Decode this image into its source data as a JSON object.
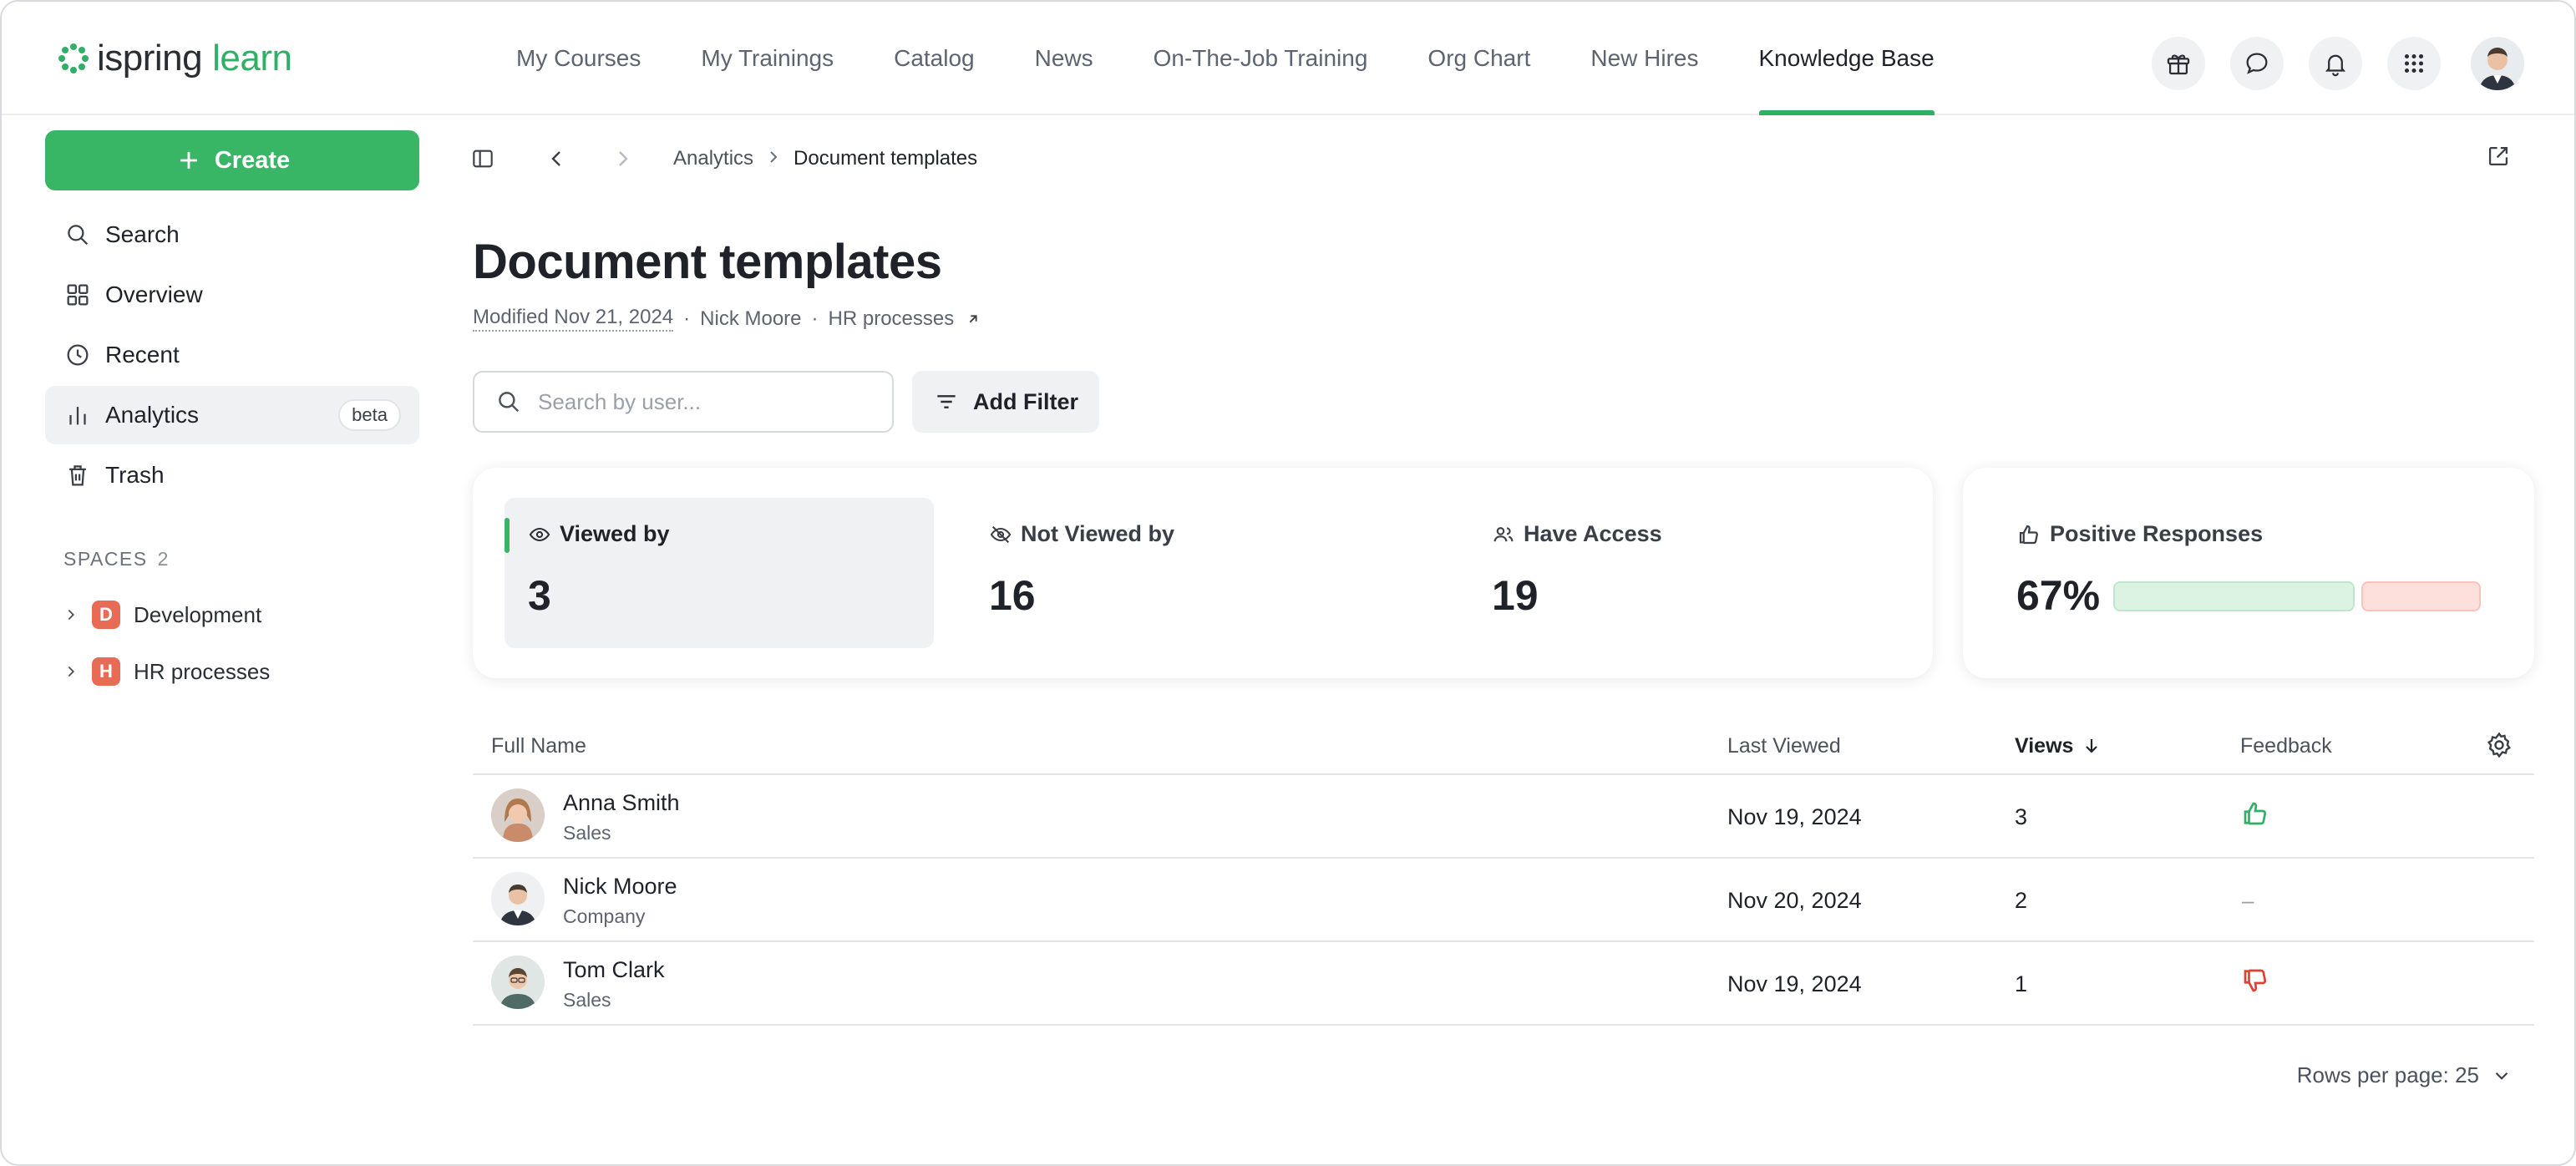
{
  "app": {
    "logo_part1": "ispring",
    "logo_part2": "learn"
  },
  "nav": {
    "items": [
      {
        "label": "My Courses"
      },
      {
        "label": "My Trainings"
      },
      {
        "label": "Catalog"
      },
      {
        "label": "News"
      },
      {
        "label": "On-The-Job Training"
      },
      {
        "label": "Org Chart"
      },
      {
        "label": "New Hires"
      },
      {
        "label": "Knowledge Base",
        "active": true
      }
    ],
    "icons": [
      "gift-icon",
      "chat-icon",
      "bell-icon",
      "apps-grid-icon"
    ]
  },
  "sidebar": {
    "create_label": "Create",
    "items": [
      {
        "label": "Search",
        "icon": "search-icon"
      },
      {
        "label": "Overview",
        "icon": "grid-icon"
      },
      {
        "label": "Recent",
        "icon": "clock-icon"
      },
      {
        "label": "Analytics",
        "icon": "bar-chart-icon",
        "badge": "beta",
        "active": true
      },
      {
        "label": "Trash",
        "icon": "trash-icon"
      }
    ],
    "spaces_label": "SPACES",
    "spaces_count": "2",
    "spaces": [
      {
        "letter": "D",
        "label": "Development"
      },
      {
        "letter": "H",
        "label": "HR processes"
      }
    ]
  },
  "breadcrumb": {
    "parent": "Analytics",
    "current": "Document templates"
  },
  "page": {
    "title": "Document templates",
    "modified": "Modified Nov 21, 2024",
    "author": "Nick Moore",
    "space": "HR processes"
  },
  "search": {
    "placeholder": "Search by user...",
    "value": ""
  },
  "filter": {
    "label": "Add Filter"
  },
  "stats": {
    "viewed_by": {
      "label": "Viewed by",
      "value": "3"
    },
    "not_viewed_by": {
      "label": "Not Viewed by",
      "value": "16"
    },
    "have_access": {
      "label": "Have Access",
      "value": "19"
    },
    "positive_responses": {
      "label": "Positive Responses",
      "value": "67%",
      "fraction": 0.67
    }
  },
  "table": {
    "columns": {
      "full_name": "Full Name",
      "last_viewed": "Last Viewed",
      "views": "Views",
      "feedback": "Feedback"
    },
    "rows": [
      {
        "name": "Anna Smith",
        "dept": "Sales",
        "last_viewed": "Nov 19, 2024",
        "views": "3",
        "feedback": "positive"
      },
      {
        "name": "Nick Moore",
        "dept": "Company",
        "last_viewed": "Nov 20, 2024",
        "views": "2",
        "feedback": "none",
        "feedback_text": "–"
      },
      {
        "name": "Tom Clark",
        "dept": "Sales",
        "last_viewed": "Nov 19, 2024",
        "views": "1",
        "feedback": "negative"
      }
    ]
  },
  "pagination": {
    "rows_per_page": "Rows per page: 25"
  },
  "colors": {
    "accent": "#39b566",
    "positive": "#2fb066",
    "negative": "#e0402f"
  }
}
